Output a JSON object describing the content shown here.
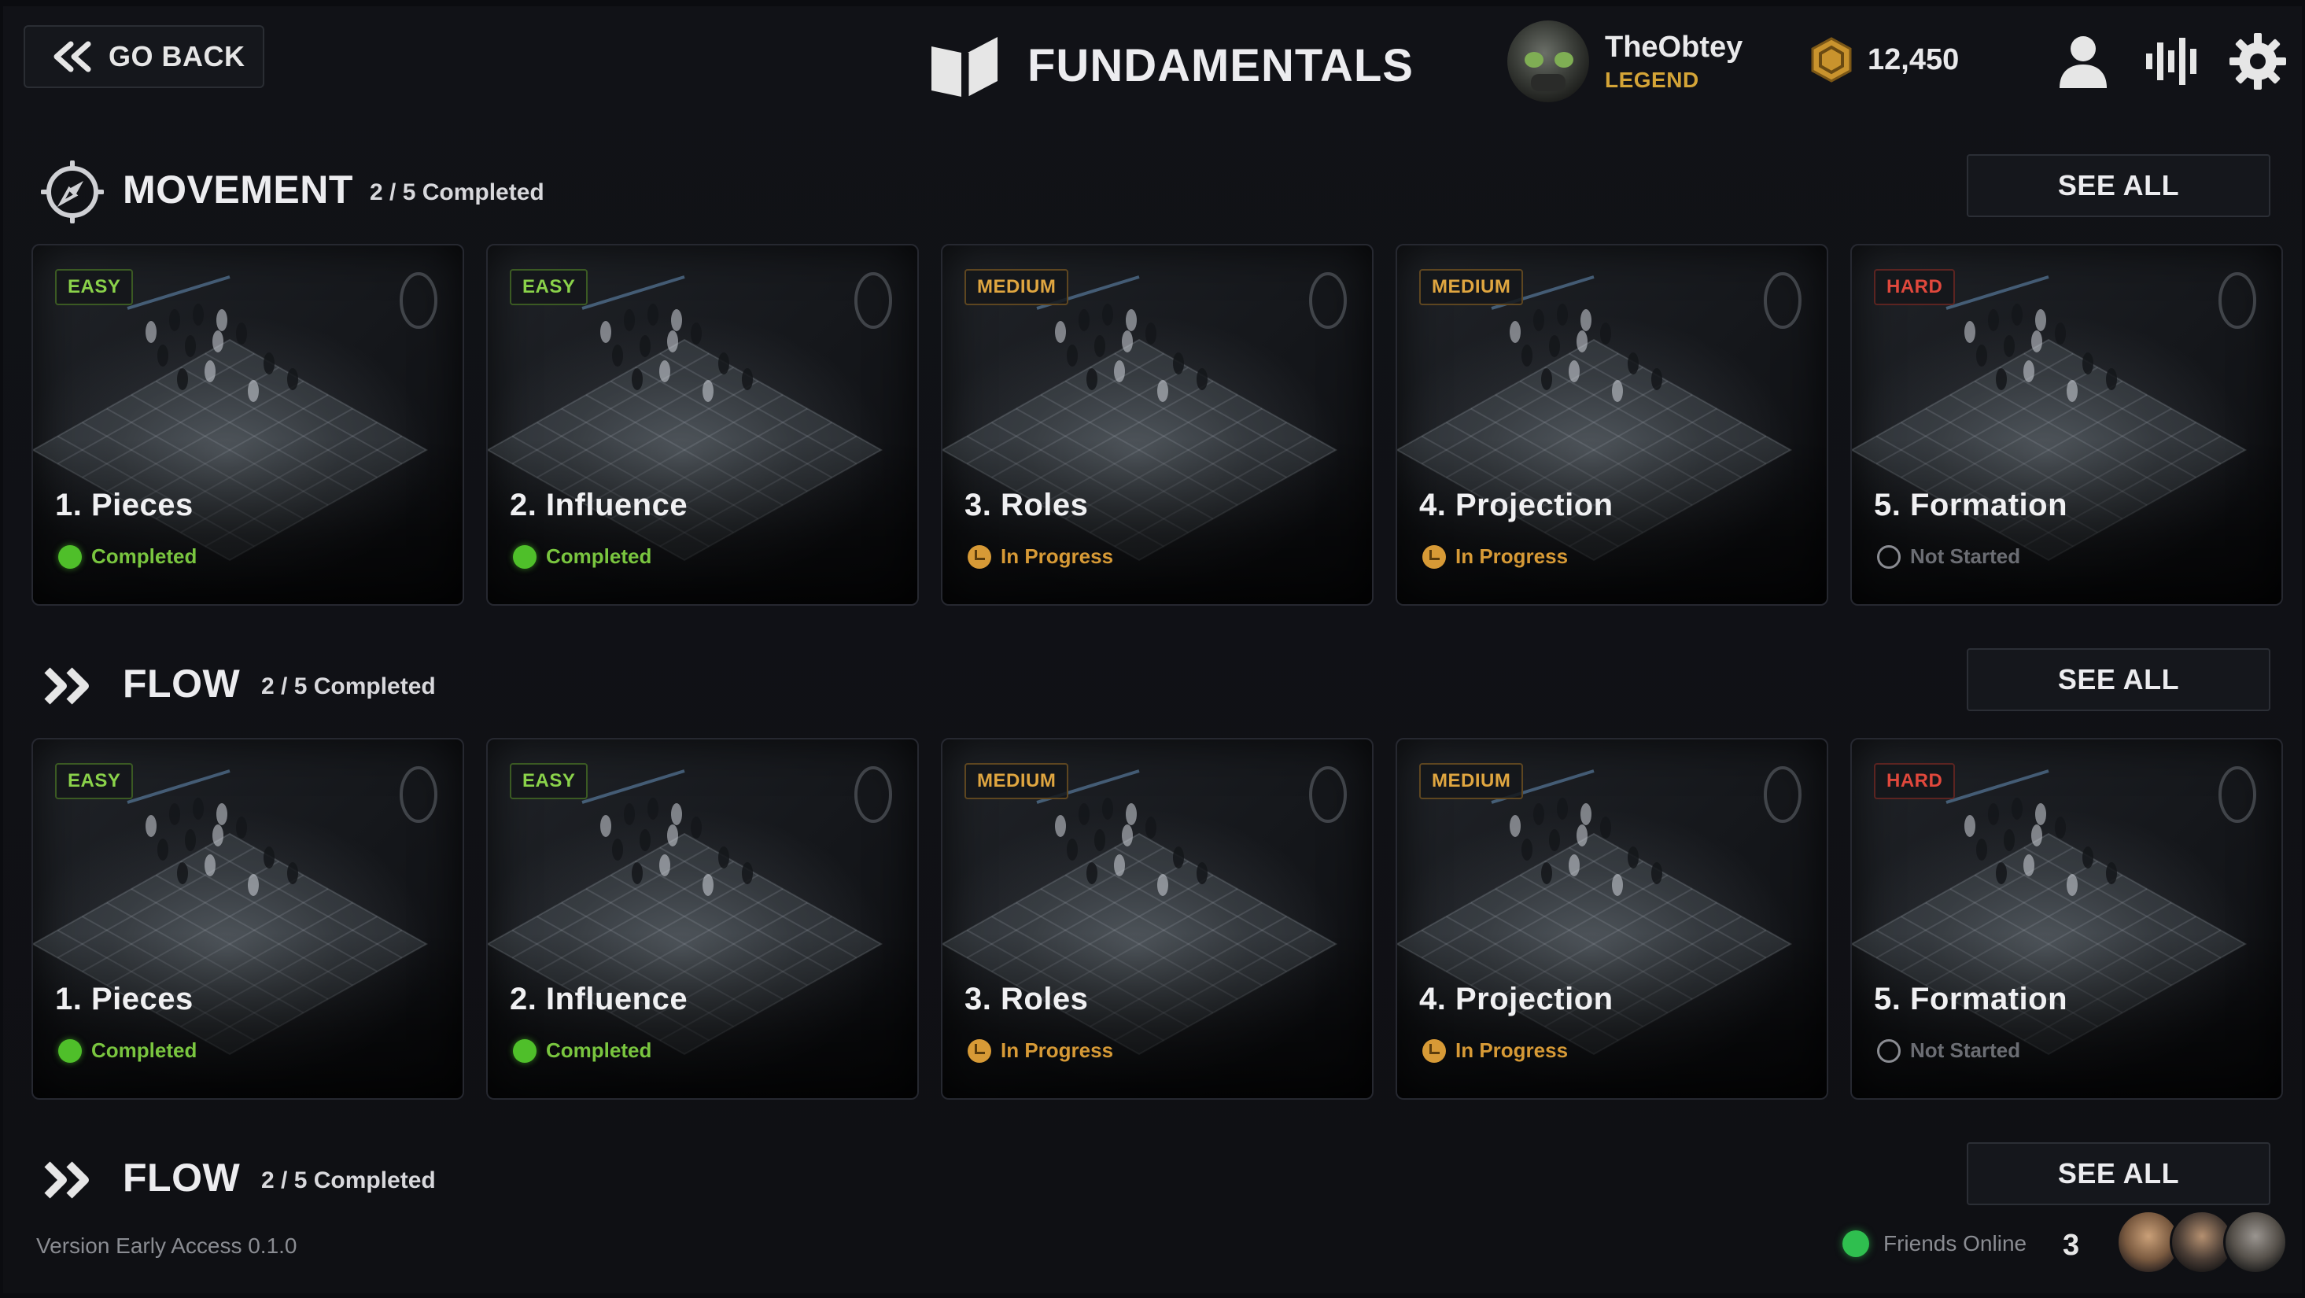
{
  "header": {
    "back_label": "GO BACK",
    "title": "FUNDAMENTALS",
    "player_name": "TheObtey",
    "player_rank": "LEGEND",
    "currency": "12,450",
    "icons": [
      "profile-icon",
      "audio-levels-icon",
      "gear-icon"
    ]
  },
  "sections": [
    {
      "title": "MOVEMENT",
      "progress": "2 / 5 Completed",
      "icon": "compass-icon",
      "see_all": "SEE ALL",
      "cards": [
        {
          "difficulty": "EASY",
          "title": "1. Pieces",
          "status": "Completed"
        },
        {
          "difficulty": "EASY",
          "title": "2. Influence",
          "status": "Completed"
        },
        {
          "difficulty": "MEDIUM",
          "title": "3. Roles",
          "status": "In Progress"
        },
        {
          "difficulty": "MEDIUM",
          "title": "4. Projection",
          "status": "In Progress"
        },
        {
          "difficulty": "HARD",
          "title": "5. Formation",
          "status": "Not Started"
        }
      ]
    },
    {
      "title": "FLOW",
      "progress": "2 / 5 Completed",
      "icon": "double-chevron-icon",
      "see_all": "SEE ALL",
      "cards": [
        {
          "difficulty": "EASY",
          "title": "1. Pieces",
          "status": "Completed"
        },
        {
          "difficulty": "EASY",
          "title": "2. Influence",
          "status": "Completed"
        },
        {
          "difficulty": "MEDIUM",
          "title": "3. Roles",
          "status": "In Progress"
        },
        {
          "difficulty": "MEDIUM",
          "title": "4. Projection",
          "status": "In Progress"
        },
        {
          "difficulty": "HARD",
          "title": "5. Formation",
          "status": "Not Started"
        }
      ]
    },
    {
      "title": "FLOW",
      "progress": "2 / 5 Completed",
      "icon": "double-chevron-icon",
      "see_all": "SEE ALL"
    }
  ],
  "footer": {
    "version": "Version Early Access 0.1.0",
    "friends_label": "Friends Online",
    "friends_count": "3"
  },
  "colors": {
    "easy": "#8ad24a",
    "medium": "#e0a640",
    "hard": "#e0483c",
    "completed": "#4fbf2a",
    "in_progress": "#d79a36",
    "legend_gold": "#d4a437"
  }
}
